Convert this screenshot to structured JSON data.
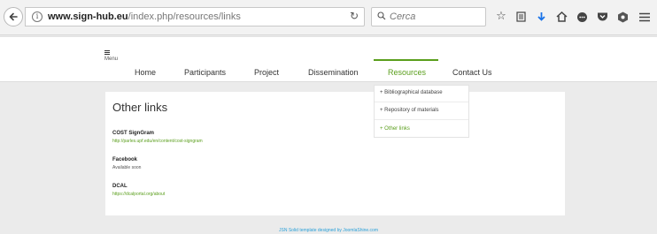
{
  "browser": {
    "url_host": "www.sign-hub.eu",
    "url_path": "/index.php/resources/links",
    "search_placeholder": "Cerca",
    "icons": [
      "back-arrow-icon",
      "info-icon",
      "reload-icon",
      "search-icon",
      "bookmark-star-icon",
      "reading-list-icon",
      "download-icon",
      "home-icon",
      "chat-icon",
      "pocket-icon",
      "extension-icon",
      "hamburger-menu-icon"
    ]
  },
  "site": {
    "menu_label": "Menu",
    "nav": [
      "Home",
      "Participants",
      "Project",
      "Dissemination",
      "Resources",
      "Contact Us"
    ],
    "active_nav": "Resources",
    "accent_color": "#5a9e1c"
  },
  "dropdown": {
    "items": [
      "+ Bibliographical database",
      "+ Repository of materials",
      "+ Other links"
    ],
    "active_item": "+ Other links"
  },
  "content": {
    "title": "Other links",
    "links": [
      {
        "title": "COST SignGram",
        "detail": "http://parles.upf.edu/en/content/cost-signgram"
      },
      {
        "title": "Facebook",
        "detail": "Available soon"
      },
      {
        "title": "DCAL",
        "detail": "https://dcalportal.org/about"
      }
    ]
  },
  "footer": {
    "credit": "JSN Solid template designed by JoomlaShine.com"
  }
}
